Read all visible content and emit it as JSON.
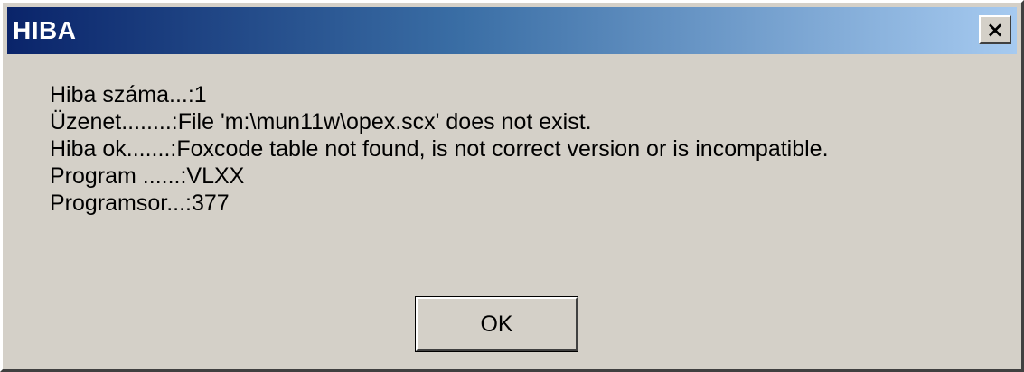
{
  "window": {
    "title": "HIBA",
    "close_icon": "×",
    "close_icon_name": "close-icon",
    "title_gradient_start": "#0a246a",
    "title_gradient_end": "#a6caf0",
    "background": "#d4d0c8"
  },
  "message": {
    "lines": [
      "Hiba száma...:1",
      "Üzenet........:File 'm:\\mun11w\\opex.scx' does not exist.",
      "Hiba ok.......:Foxcode table not found, is not correct version or is incompatible.",
      "Program ......:VLXX",
      "Programsor...:377"
    ]
  },
  "buttons": {
    "ok_label": "OK"
  }
}
